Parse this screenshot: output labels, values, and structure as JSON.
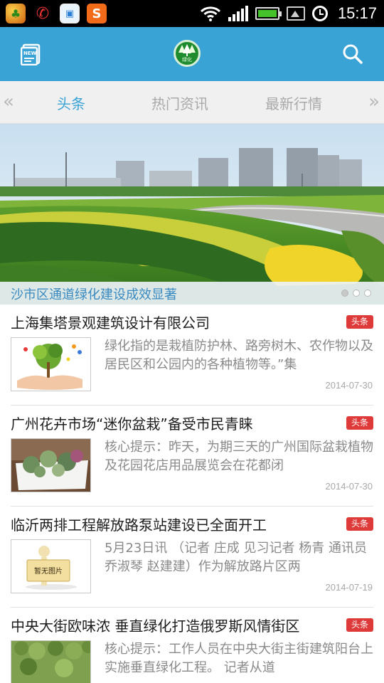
{
  "status_bar": {
    "time": "15:17",
    "battery_level": 1.0,
    "signal_bars": 4,
    "icons": [
      "app-icon",
      "missed-call-icon",
      "photo-app-icon",
      "sogou-s-icon",
      "wifi-icon",
      "signal-icon",
      "battery-icon",
      "screenshot-icon",
      "alarm-icon"
    ]
  },
  "header": {
    "logo_text": "绿化",
    "news_icon": "news-icon",
    "search_icon": "search-icon",
    "accent_color": "#3aa3d6"
  },
  "tabs": {
    "prev_arrow": "«",
    "next_arrow": "»",
    "items": [
      {
        "label": "头条",
        "active": true
      },
      {
        "label": "热门资讯",
        "active": false
      },
      {
        "label": "最新行情",
        "active": false
      }
    ]
  },
  "banner": {
    "caption": "沙市区通道绿化建设成效显著",
    "page_count": 3,
    "current_page": 1
  },
  "news": [
    {
      "title": "上海集塔景观建筑设计有限公司",
      "badge": "头条",
      "summary": "绿化指的是栽植防护林、路旁树木、农作物以及居民区和公园内的各种植物等。”集",
      "date": "2014-07-30",
      "thumb": "tree-hands"
    },
    {
      "title": "广州花卉市场“迷你盆栽”备受市民青睐",
      "badge": "头条",
      "summary": "核心提示：昨天，为期三天的广州国际盆栽植物及花园花店用品展览会在花都闭",
      "date": "2014-07-30",
      "thumb": "succulents"
    },
    {
      "title": "临沂两排工程解放路泵站建设已全面开工",
      "badge": "头条",
      "summary": "5月23日讯 （记者 庄成 见习记者 杨青 通讯员 乔淑琴 赵建建）作为解放路片区两",
      "date": "2014-07-19",
      "thumb": "no-image",
      "thumb_text": "暂无图片"
    },
    {
      "title": "中央大街欧味浓 垂直绿化打造俄罗斯风情街区",
      "badge": "头条",
      "summary": "核心提示：工作人员在中央大街主街建筑阳台上实施垂直绿化工程。   记者从道",
      "date": "",
      "thumb": "garden"
    }
  ]
}
